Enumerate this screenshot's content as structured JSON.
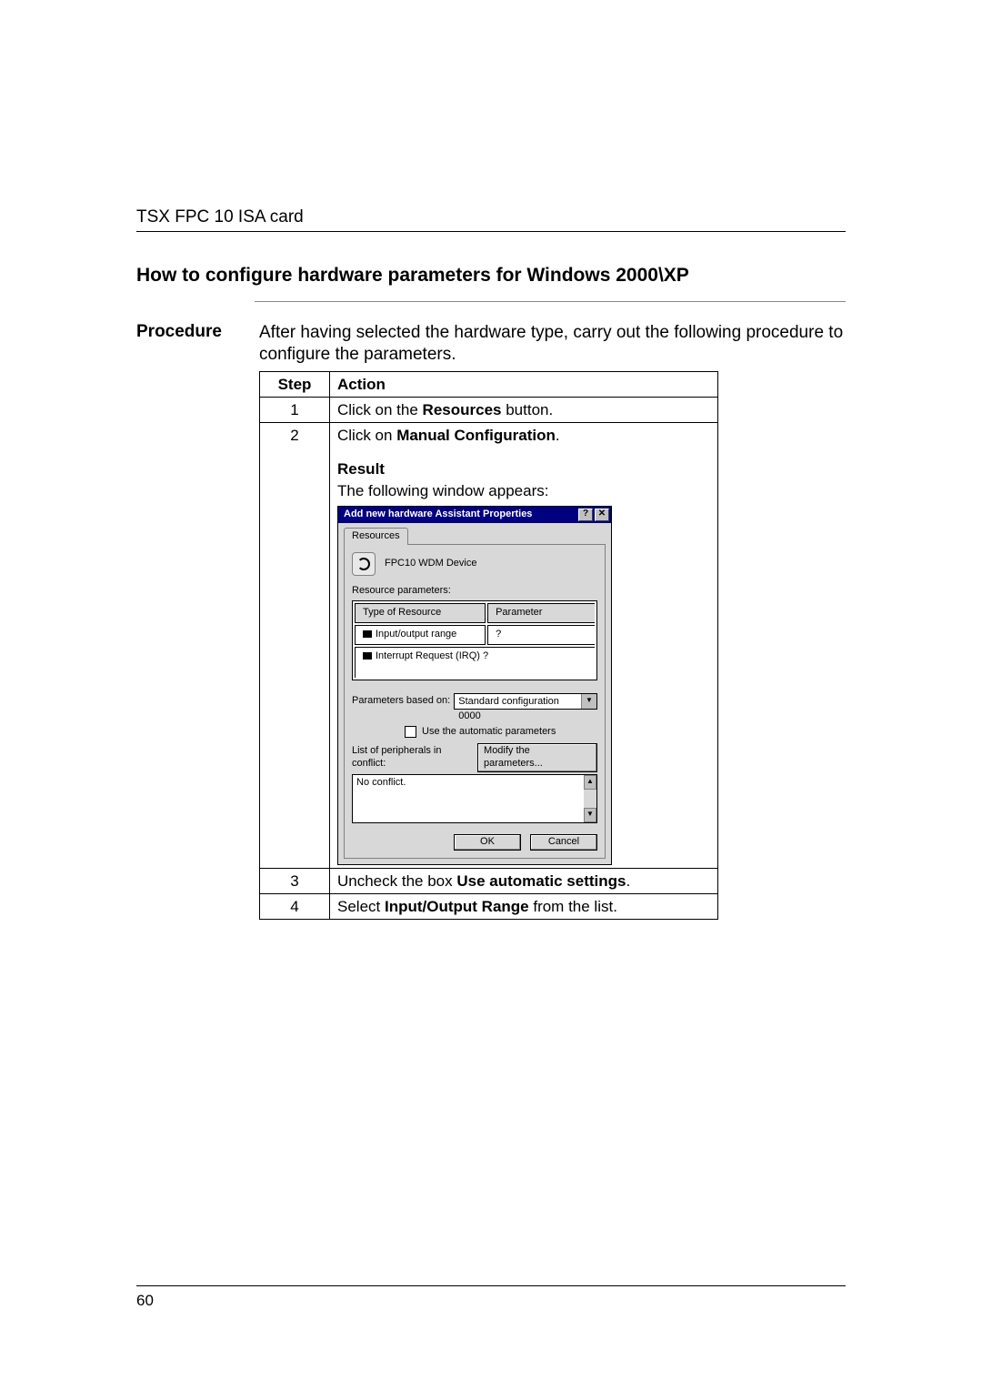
{
  "header": {
    "running_head": "TSX FPC 10 ISA card"
  },
  "title": "How to configure hardware parameters for Windows 2000\\XP",
  "procedure": {
    "label": "Procedure",
    "intro": "After having selected the hardware type, carry out the following procedure to configure the parameters."
  },
  "table": {
    "head_step": "Step",
    "head_action": "Action",
    "rows": {
      "r1": {
        "num": "1",
        "pre": "Click on the ",
        "bold": "Resources",
        "post": " button."
      },
      "r2": {
        "num": "2",
        "line_pre": "Click on ",
        "line_bold": "Manual Configuration",
        "line_post": ".",
        "result_label": "Result",
        "result_text": "The following window appears:"
      },
      "r3": {
        "num": "3",
        "pre": "Uncheck the box ",
        "bold": "Use automatic settings",
        "post": "."
      },
      "r4": {
        "num": "4",
        "pre": "Select ",
        "bold": "Input/Output Range",
        "post": " from the list."
      }
    }
  },
  "dialog": {
    "title": "Add new hardware Assistant Properties",
    "help_btn": "?",
    "close_btn": "✕",
    "tab": "Resources",
    "device_name": "FPC10 WDM Device",
    "param_label": "Resource parameters:",
    "col_type": "Type of Resource",
    "col_param": "Parameter",
    "row_io": "Input/output range",
    "row_io_val": "?",
    "row_irq": "Interrupt Request (IRQ) ?",
    "based_label": "Parameters based on:",
    "based_value": "Standard configuration 0000",
    "auto_chk": "Use the automatic parameters",
    "conflict_label": "List of peripherals in conflict:",
    "modify_btn": "Modify the parameters...",
    "no_conflict": "No conflict.",
    "ok": "OK",
    "cancel": "Cancel"
  },
  "page_number": "60"
}
